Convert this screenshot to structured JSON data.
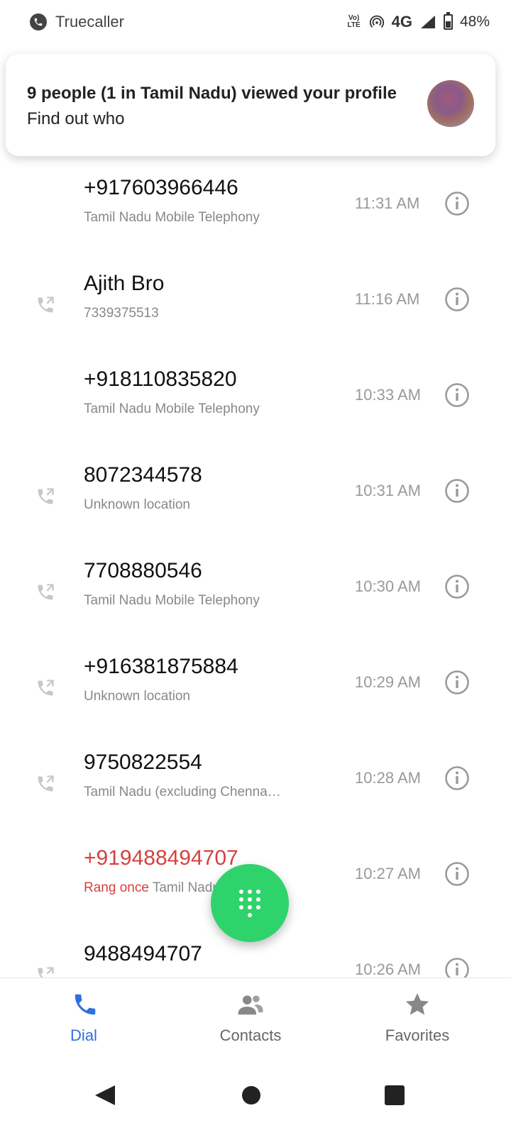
{
  "status_bar": {
    "app_name": "Truecaller",
    "volte": "Vo)\nLTE",
    "network": "4G",
    "battery_percent": "48%",
    "battery_level": 0.48
  },
  "notification": {
    "title": "9 people (1 in Tamil Nadu) viewed your profile",
    "subtitle": "Find out who"
  },
  "calls": [
    {
      "name": "+917603966446",
      "sub": "Tamil Nadu Mobile Telephony",
      "time": "11:31 AM",
      "type": "none"
    },
    {
      "name": "Ajith Bro",
      "sub": "7339375513",
      "time": "11:16 AM",
      "type": "outgoing"
    },
    {
      "name": "+918110835820",
      "sub": "Tamil Nadu Mobile Telephony",
      "time": "10:33 AM",
      "type": "none"
    },
    {
      "name": "8072344578",
      "sub": "Unknown location",
      "time": "10:31 AM",
      "type": "outgoing"
    },
    {
      "name": "7708880546",
      "sub": "Tamil Nadu Mobile Telephony",
      "time": "10:30 AM",
      "type": "outgoing"
    },
    {
      "name": "+916381875884",
      "sub": "Unknown location",
      "time": "10:29 AM",
      "type": "outgoing"
    },
    {
      "name": "9750822554",
      "sub": "Tamil Nadu (excluding Chenna…",
      "time": "10:28 AM",
      "type": "outgoing"
    },
    {
      "name": "+919488494707",
      "sub_prefix": "Rang once",
      "sub": "Tamil Nadu",
      "time": "10:27 AM",
      "type": "missed"
    },
    {
      "name": "9488494707",
      "sub": "",
      "time": "10:26 AM",
      "type": "outgoing"
    }
  ],
  "bottom_nav": {
    "dial": "Dial",
    "contacts": "Contacts",
    "favorites": "Favorites"
  },
  "colors": {
    "accent": "#2f6fe0",
    "fab": "#2fd36b",
    "missed": "#d64040"
  }
}
